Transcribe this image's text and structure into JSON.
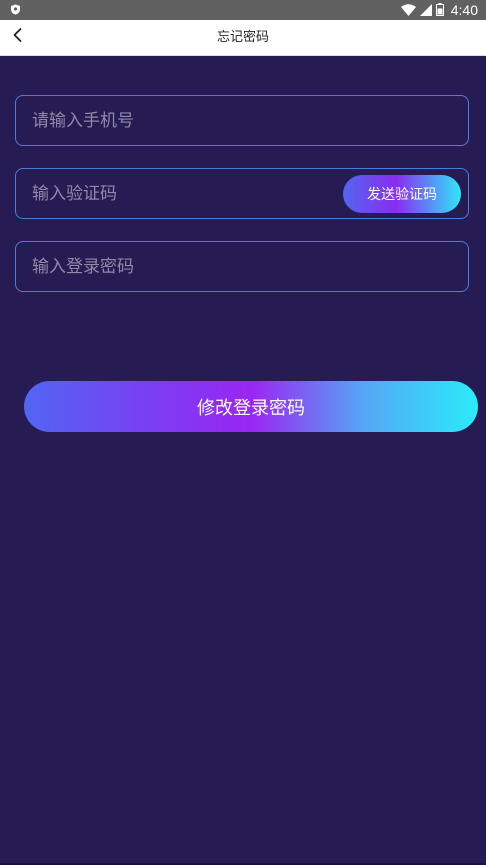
{
  "status_bar": {
    "time": "4:40",
    "icons": [
      "shield-icon",
      "wifi-icon",
      "signal-icon",
      "battery-icon"
    ]
  },
  "app_bar": {
    "title": "忘记密码",
    "back_icon": "chevron-left-icon"
  },
  "form": {
    "phone": {
      "placeholder": "请输入手机号",
      "value": ""
    },
    "code": {
      "placeholder": "输入验证码",
      "value": "",
      "send_label": "发送验证码"
    },
    "password": {
      "placeholder": "输入登录密码",
      "value": ""
    },
    "submit_label": "修改登录密码"
  },
  "colors": {
    "background": "#261b53",
    "field_border": "#4a7fd9",
    "placeholder": "#8f8aa8",
    "gradient_start": "#5166f3",
    "gradient_mid": "#9a26f2",
    "gradient_end": "#2aebfa",
    "status_bar": "#616161",
    "app_bar": "#ffffff"
  }
}
